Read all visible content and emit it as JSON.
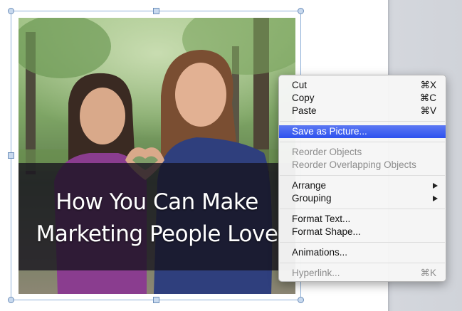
{
  "slide": {
    "caption_line1": "How You Can Make",
    "caption_line2": "Marketing People Love"
  },
  "context_menu": {
    "items": [
      {
        "label": "Cut",
        "shortcut": "⌘X",
        "enabled": true
      },
      {
        "label": "Copy",
        "shortcut": "⌘C",
        "enabled": true
      },
      {
        "label": "Paste",
        "shortcut": "⌘V",
        "enabled": true
      },
      {
        "label": "Save as Picture...",
        "shortcut": "",
        "enabled": true,
        "highlighted": true
      },
      {
        "label": "Reorder Objects",
        "shortcut": "",
        "enabled": false
      },
      {
        "label": "Reorder Overlapping Objects",
        "shortcut": "",
        "enabled": false
      },
      {
        "label": "Arrange",
        "shortcut": "",
        "enabled": true,
        "submenu": true
      },
      {
        "label": "Grouping",
        "shortcut": "",
        "enabled": true,
        "submenu": true
      },
      {
        "label": "Format Text...",
        "shortcut": "",
        "enabled": true
      },
      {
        "label": "Format Shape...",
        "shortcut": "",
        "enabled": true
      },
      {
        "label": "Animations...",
        "shortcut": "",
        "enabled": true
      },
      {
        "label": "Hyperlink...",
        "shortcut": "⌘K",
        "enabled": false
      }
    ]
  },
  "colors": {
    "highlight": "#2d51ee",
    "disabled_text": "#8c8c8c",
    "selection_handle": "#6d8fba"
  }
}
